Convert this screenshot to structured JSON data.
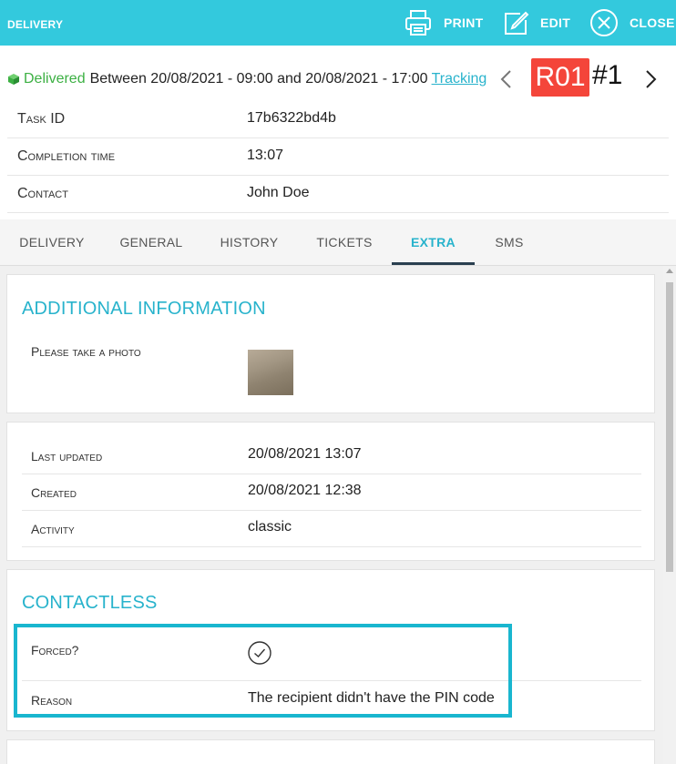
{
  "header": {
    "title": "DELIVERY",
    "print_label": "PRINT",
    "edit_label": "EDIT",
    "close_label": "CLOSE"
  },
  "status": {
    "icon": "cube-icon",
    "state": "Delivered",
    "window": "Between 20/08/2021 - 09:00 and 20/08/2021 - 17:00",
    "tracking_label": "Tracking",
    "route_code": "R01",
    "route_number": "#1",
    "route_color": "#f4453a"
  },
  "summary": [
    {
      "label": "Task ID",
      "value": "17b6322bd4b"
    },
    {
      "label": "Completion time",
      "value": "13:07"
    },
    {
      "label": "Contact",
      "value": "John Doe"
    }
  ],
  "tabs": [
    {
      "label": "DELIVERY"
    },
    {
      "label": "GENERAL"
    },
    {
      "label": "HISTORY"
    },
    {
      "label": "TICKETS"
    },
    {
      "label": "EXTRA",
      "active": true
    },
    {
      "label": "SMS"
    }
  ],
  "additional": {
    "title": "ADDITIONAL INFORMATION",
    "photo_label": "Please take a photo"
  },
  "meta": [
    {
      "label": "Last updated",
      "value": "20/08/2021 13:07"
    },
    {
      "label": "Created",
      "value": "20/08/2021 12:38"
    },
    {
      "label": "Activity",
      "value": "classic"
    }
  ],
  "contactless": {
    "title": "CONTACTLESS",
    "forced_label": "Forced?",
    "forced_icon": "check-circle-icon",
    "reason_label": "Reason",
    "reason_value": "The recipient didn't have the PIN code"
  },
  "colors": {
    "accent": "#33c9dd",
    "link": "#28b3cc",
    "delivered": "#3cb043",
    "highlight": "#19b6cf"
  }
}
